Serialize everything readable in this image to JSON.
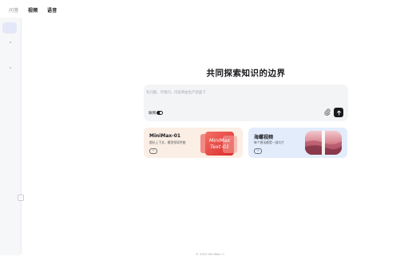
{
  "topnav": {
    "item1": "问答",
    "item2": "视频",
    "item3": "语音"
  },
  "hero": {
    "title": "共同探索知识的边界"
  },
  "composer": {
    "placeholder": "有问题，尽管问，内容将由生产后面下",
    "net_label": "联网",
    "net_enabled": true
  },
  "cards": [
    {
      "title": "MiniMax-01",
      "desc": "超长上下文，模型领导性能",
      "art_text_1": "MiniMax",
      "art_text_2": "Text-01"
    },
    {
      "title": "海螺视频",
      "desc": "每个想法都是一部大片"
    }
  ],
  "footer": {
    "text": "© 2025 MiniMax →"
  },
  "colors": {
    "accent_red": "#e2453f",
    "card_warm": "#fbeee4",
    "card_cool": "#e2ecfb"
  }
}
